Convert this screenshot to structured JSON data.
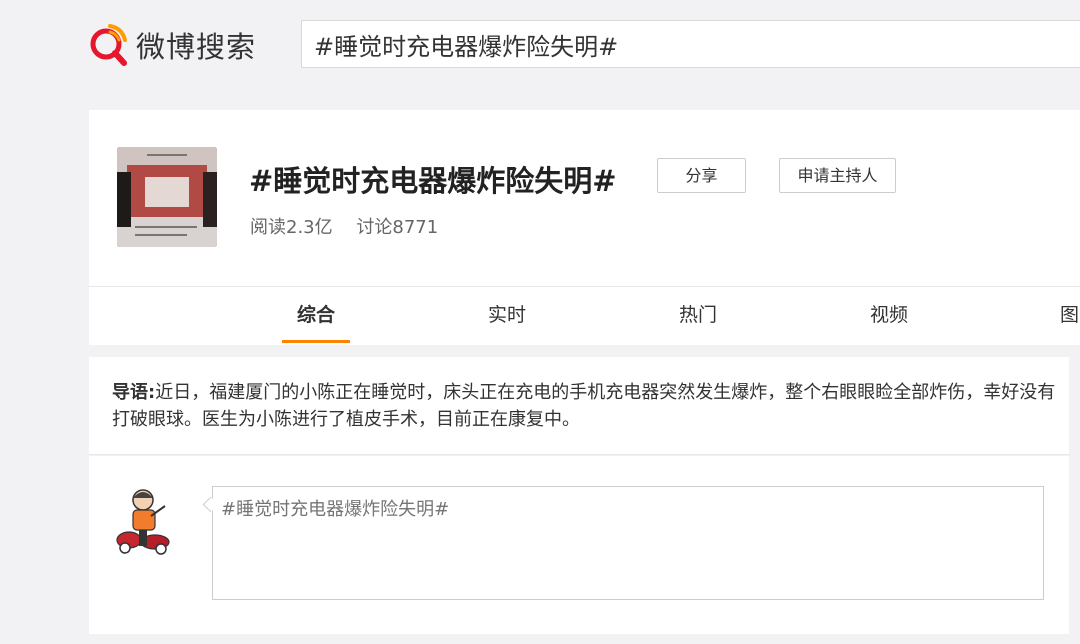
{
  "header": {
    "logo_text": "微博搜索",
    "search_value": "#睡觉时充电器爆炸险失明#"
  },
  "topic": {
    "title": "#睡觉时充电器爆炸险失明#",
    "reads": "阅读2.3亿",
    "discussions": "讨论8771",
    "share_label": "分享",
    "host_label": "申请主持人"
  },
  "tabs": [
    {
      "label": "综合",
      "active": true
    },
    {
      "label": "实时",
      "active": false
    },
    {
      "label": "热门",
      "active": false
    },
    {
      "label": "视频",
      "active": false
    },
    {
      "label": "图",
      "active": false
    }
  ],
  "intro": {
    "label": "导语:",
    "text": "近日，福建厦门的小陈正在睡觉时，床头正在充电的手机充电器突然发生爆炸，整个右眼眼睑全部炸伤，幸好没有打破眼球。医生为小陈进行了植皮手术，目前正在康复中。"
  },
  "compose": {
    "placeholder": "#睡觉时充电器爆炸险失明#"
  },
  "colors": {
    "accent": "#ff8200",
    "logo_red": "#e6162d"
  }
}
